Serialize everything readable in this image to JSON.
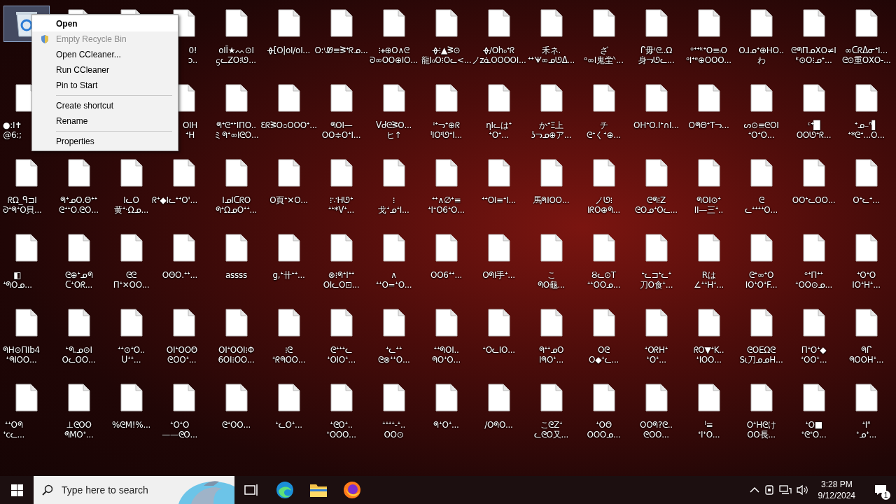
{
  "desktop": {
    "icons": [
      {
        "kind": "recycle-bin",
        "selected": true
      },
      {
        "kind": "file",
        "selected": false
      },
      {
        "kind": "file",
        "selected": false
      },
      {
        "kind": "file",
        "selected": false,
        "label": [
          "0!",
          "ɔ.."
        ]
      },
      {
        "kind": "file",
        "selected": false,
        "label": [
          "oΙΪ★ᨓ⊙Ι",
          "ᦓᓚΖΟ⁝ᘎ..."
        ]
      },
      {
        "kind": "file",
        "selected": false,
        "label": [
          "ᚖ[Ο|oΙ/oΙ..."
        ]
      },
      {
        "kind": "file",
        "selected": false,
        "label": [
          "Ο:ᶦᏪ≡ᕒᐩᖇᓄ..."
        ]
      },
      {
        "kind": "file",
        "selected": false,
        "label": [
          "⁝ᚐ⊕O∧ᘓ",
          "ᘐ∞ΟΟ⊕ΙΟ..."
        ]
      },
      {
        "kind": "file",
        "selected": false,
        "label": [
          "ᚖ⁝▲ᕒ⊙",
          "龍Ι₀Ο⁝Οᓚ<..."
        ]
      },
      {
        "kind": "file",
        "selected": false,
        "label": [
          "ᚖ∕Οh₀ᐩᖇ",
          "ノzᓈΟΟΟΟΙ..."
        ]
      },
      {
        "kind": "file",
        "selected": false,
        "label": [
          "禾ネ.",
          "ᐩᐩᗖ∞ᓄᘎᐃ..."
        ]
      },
      {
        "kind": "file",
        "selected": false,
        "label": [
          "ざ",
          "ᵒ∞Ι鬼坣ᐠ..."
        ]
      },
      {
        "kind": "file",
        "selected": false,
        "label": [
          "ᒋ毋ᶦᘓ..Ω",
          "身ᓓᘎᓚ..."
        ]
      },
      {
        "kind": "file",
        "selected": false,
        "label": [
          "ᵒᐩᐩᵏᐩΟ≡ᵢΟ",
          "ᵒΙᐩᵉ⊕ΟΟΟ..."
        ]
      },
      {
        "kind": "file",
        "selected": false,
        "label": [
          "Ο⅃ᓄᐩ⊕ΗΟ..",
          "わ"
        ]
      },
      {
        "kind": "file",
        "selected": false,
        "label": [
          "ᘓᖗΠᓄXΟ≠Ι",
          "ᵏ⊙Ο⁝ᓄᐩ..."
        ]
      },
      {
        "kind": "file",
        "selected": false,
        "label": [
          "∞ᑕᖇᐃᓂᐩΙ...",
          "ᘓ⊙重ΟXΟ-..."
        ]
      },
      {
        "kind": "file",
        "selected": false,
        "label": [
          "●:I✝",
          "@6:;"
        ]
      },
      {
        "kind": "hidden"
      },
      {
        "kind": "hidden"
      },
      {
        "kind": "file",
        "selected": false,
        "label": [
          "ΟΙH",
          "ᐩΗ"
        ]
      },
      {
        "kind": "file",
        "selected": false,
        "label": [
          "ᖗᐩᘓᐩᐩΙΠΟ..",
          "ミᖗᐩ∞ΙᘓΟ..."
        ]
      },
      {
        "kind": "file",
        "selected": false,
        "label": [
          "ƐᖇᕒΟ೦ΟΟΟᐩ..."
        ]
      },
      {
        "kind": "file",
        "selected": false,
        "label": [
          "ᖗΟΙ—",
          "ΟΟ≑ΟᐩΙ..."
        ]
      },
      {
        "kind": "file",
        "selected": false,
        "label": [
          "ᐯᑯᘓᕒΟ...",
          "ヒ↑"
        ]
      },
      {
        "kind": "file",
        "selected": false,
        "label": [
          "ᶦᐩᓓᐩ⊕ᖇ",
          "ᑊΙΟᶦᘎᐩΙ..."
        ]
      },
      {
        "kind": "file",
        "selected": false,
        "label": [
          "ηΙᓚはᐩ",
          "ᐩΟᐩ..."
        ]
      },
      {
        "kind": "file",
        "selected": false,
        "label": [
          "かᐩΞ上",
          "ʖᓓᓄ⊕ア..."
        ]
      },
      {
        "kind": "file",
        "selected": false,
        "label": [
          "チ",
          "ᘓᐩくᐩ⊕..."
        ]
      },
      {
        "kind": "file",
        "selected": false,
        "label": [
          "ΟΗᐩΟ.Ιᐩ∩Ι..."
        ]
      },
      {
        "kind": "file",
        "selected": false,
        "label": [
          "ΟᖗΘᐩΤᓓ..."
        ]
      },
      {
        "kind": "file",
        "selected": false,
        "label": [
          "ᔕ⊙≡ᘓΟΙ",
          "ᐩΟᐩΟ..."
        ]
      },
      {
        "kind": "file",
        "selected": false,
        "label": [
          "ᶜᐩ█",
          "ΟΟᘎᐩᖇ..."
        ]
      },
      {
        "kind": "file",
        "selected": false,
        "label": [
          "ᐩᓄ₋ᐢ▌",
          "ᐩ*ᘓᐩ...Ο..."
        ]
      },
      {
        "kind": "file",
        "selected": false,
        "label": [
          "ᖇΩ_ᑫ⊐Ι",
          "ᘐᐩᖗᐩΟ貝..."
        ]
      },
      {
        "kind": "file",
        "selected": false,
        "label": [
          "ᖗᐩᓄΟ.Θᐩᐩ",
          "ᘓᐩᐩΟ.ᘓΟ..."
        ]
      },
      {
        "kind": "file",
        "selected": false,
        "label": [
          "ΙᓚΟ",
          "黄ᐩ·Ωᓄ..."
        ]
      },
      {
        "kind": "file",
        "selected": false,
        "label": [
          "ᖇᐩ◆ΙᓚᐩᐩΟ'..."
        ]
      },
      {
        "kind": "file",
        "selected": false,
        "label": [
          "ΙᓄΙᑕᖇΟ",
          "ᖗᐩΩᓄΟᐩᐩ..."
        ]
      },
      {
        "kind": "file",
        "selected": false,
        "label": [
          "Ο頁ᐩ✕Ο..."
        ]
      },
      {
        "kind": "file",
        "selected": false,
        "label": [
          "⁝∵Ηᘎᐩ",
          "ᐩᐩ*ᐯᐩ..."
        ]
      },
      {
        "kind": "file",
        "selected": false,
        "label": [
          "⁝",
          "戈ᐩᓄᐩΙ..."
        ]
      },
      {
        "kind": "file",
        "selected": false,
        "label": [
          "ᐩᐩ∧∅ᐩ≡",
          "ᐩΙᐩΟ6ᐩΟ..."
        ]
      },
      {
        "kind": "file",
        "selected": false,
        "label": [
          "ᐩᐩΟΙ≡ᐩΙ..."
        ]
      },
      {
        "kind": "file",
        "selected": false,
        "label": [
          "馬ᖗΙΟΟ..."
        ]
      },
      {
        "kind": "file",
        "selected": false,
        "label": [
          "ノᘎ⁝",
          "ΙᖇΟ⊕ᖗ..."
        ]
      },
      {
        "kind": "file",
        "selected": false,
        "label": [
          "ᘓᖗ⁝Z",
          "ᘓΟᓄᐩΟᓚ..."
        ]
      },
      {
        "kind": "file",
        "selected": false,
        "label": [
          "ᖗΟΙ⊙ᐩ",
          "ΙΙ—三ᐩ.."
        ]
      },
      {
        "kind": "file",
        "selected": false,
        "label": [
          "ᘓ",
          "ᓚᐩᐩᐩᐩΟ..."
        ]
      },
      {
        "kind": "file",
        "selected": false,
        "label": [
          "ΟΟᐩᓚΟΟ..."
        ]
      },
      {
        "kind": "file",
        "selected": false,
        "label": [
          "Οᐩᓚᐩ..."
        ]
      },
      {
        "kind": "file",
        "selected": false,
        "label": [
          "◧",
          "ᐩᖗΟᓄ..."
        ]
      },
      {
        "kind": "file",
        "selected": false,
        "label": [
          "ᘓ⊕ᐩᓄᖗ",
          "ᑕᐩΟᖇ..."
        ]
      },
      {
        "kind": "file",
        "selected": false,
        "label": [
          "ᘓᘓ",
          "Πᐩ✕ΟΟ..."
        ]
      },
      {
        "kind": "file",
        "selected": false,
        "label": [
          "ΟΘΟ.ᐩᐩ..."
        ]
      },
      {
        "kind": "file",
        "selected": false,
        "label": [
          "assss"
        ]
      },
      {
        "kind": "file",
        "selected": false,
        "label": [
          "g,ᐩ卄ᐩᐩ..."
        ]
      },
      {
        "kind": "file",
        "selected": false,
        "label": [
          "⊗⁝ᖗᐩΙᐩᐩ",
          "ΟΙᓚΟ⊡..."
        ]
      },
      {
        "kind": "file",
        "selected": false,
        "label": [
          "∧",
          "ᐩᐩΟ=ᐩΟ..."
        ]
      },
      {
        "kind": "file",
        "selected": false,
        "label": [
          "ΟΟ6ᐩᐩ..."
        ]
      },
      {
        "kind": "file",
        "selected": false,
        "label": [
          "ΟᖗΙ手ᐩ..."
        ]
      },
      {
        "kind": "file",
        "selected": false,
        "label": [
          "こ",
          "ᖗΟ龜..."
        ]
      },
      {
        "kind": "file",
        "selected": false,
        "label": [
          "Ȣᓚ⊙Τ",
          "ᐩᐩΟΟᓄ..."
        ]
      },
      {
        "kind": "file",
        "selected": false,
        "label": [
          "ᐩᓚ⊐ᐩᓚᐩ",
          "刀Ο食ᐩ..."
        ]
      },
      {
        "kind": "file",
        "selected": false,
        "label": [
          "Rは",
          "∠ᐩᐩΗᐩ..."
        ]
      },
      {
        "kind": "file",
        "selected": false,
        "label": [
          "ᘓᐩ∞ᐩΟ",
          "ΙΟᐩΟᐩF..."
        ]
      },
      {
        "kind": "file",
        "selected": false,
        "label": [
          "ᵒᐩΠᐩᐩ",
          "ᐩΟΟ⊙ᓄ..."
        ]
      },
      {
        "kind": "file",
        "selected": false,
        "label": [
          "ᐩΟᐩΟ",
          "ΙΟᐩΗᐩ..."
        ]
      },
      {
        "kind": "file",
        "selected": false,
        "label": [
          "ᖗΗ⊙ΠΙb4",
          "ᐩᖗΙΟΟ..."
        ]
      },
      {
        "kind": "file",
        "selected": false,
        "label": [
          "ᐩᖗ.ᓄ⊙Ι",
          "ΟᓚΟΟ..."
        ]
      },
      {
        "kind": "file",
        "selected": false,
        "label": [
          "ᐩᐩ⊙ᐩΟ..",
          "ᑌᐩᐩ..."
        ]
      },
      {
        "kind": "file",
        "selected": false,
        "label": [
          "ΟΙᐩΟΟΘ",
          "ᘓΟΟᐩ..."
        ]
      },
      {
        "kind": "file",
        "selected": false,
        "label": [
          "ΟΙᐩΟΟΙ⁝Φ",
          "6ΟΙ⁝ΟΟ..."
        ]
      },
      {
        "kind": "file",
        "selected": false,
        "label": [
          "⁝ᘓ",
          "ᐩᖇᖗΟΟ..."
        ]
      },
      {
        "kind": "file",
        "selected": false,
        "label": [
          "ᘓᐩᐩᐩᓚ",
          "ᐩΟΙΟᐩ..."
        ]
      },
      {
        "kind": "file",
        "selected": false,
        "label": [
          "ᐩᓚᐩᐩ",
          "ᘓ⊗ᐩᐩΟ..."
        ]
      },
      {
        "kind": "file",
        "selected": false,
        "label": [
          "ᐩᐩᖗΟΙ..",
          "ᖗΟᐩΟ..."
        ]
      },
      {
        "kind": "file",
        "selected": false,
        "label": [
          "ᐩΟᓚΙΟ..."
        ]
      },
      {
        "kind": "file",
        "selected": false,
        "label": [
          "ᖗᐩᐩᓄΟ",
          "ΙᖗΟᐩ..."
        ]
      },
      {
        "kind": "file",
        "selected": false,
        "label": [
          "Οᘓ",
          "Ο◆ᐩᓚ..."
        ]
      },
      {
        "kind": "file",
        "selected": false,
        "label": [
          "ᐩΟᖇΗᐩ",
          "ᐩΟᐩ..."
        ]
      },
      {
        "kind": "file",
        "selected": false,
        "label": [
          "ᖇΟ▼ᐩΚ..",
          "ᐩΙΟΟ..."
        ]
      },
      {
        "kind": "file",
        "selected": false,
        "label": [
          "ᘓΟΕΩᘓ",
          "Sι刀ᓄᓄΗ..."
        ]
      },
      {
        "kind": "file",
        "selected": false,
        "label": [
          "ΠᐩΟᐩ◆",
          "ᐩΟΟᐩ..."
        ]
      },
      {
        "kind": "file",
        "selected": false,
        "label": [
          "ᖗᒋ",
          "ᖗΟΟΗᐩ..."
        ]
      },
      {
        "kind": "file",
        "selected": false,
        "label": [
          "ᐩᐩΟᖗ",
          "ᐩcᓚ..."
        ]
      },
      {
        "kind": "file",
        "selected": false,
        "label": [
          "⊥ᘓΟΟ",
          "ᖗΜΟᐩ..."
        ]
      },
      {
        "kind": "file",
        "selected": false,
        "label": [
          "%ᘓΜ!%..."
        ]
      },
      {
        "kind": "file",
        "selected": false,
        "label": [
          "ᐩΟᐩΟ",
          "——ᘓΟ..."
        ]
      },
      {
        "kind": "file",
        "selected": false,
        "label": [
          "ᘓᐩΟΟ..."
        ]
      },
      {
        "kind": "file",
        "selected": false,
        "label": [
          "ᐩᓚΟᐩ..."
        ]
      },
      {
        "kind": "file",
        "selected": false,
        "label": [
          "ᐩᘓΟᐩ..",
          "ᐩΟΟΟ..."
        ]
      },
      {
        "kind": "file",
        "selected": false,
        "label": [
          "ᐩᐩᐩᐩ-ᐩ..",
          "ΟΟ⊙"
        ]
      },
      {
        "kind": "file",
        "selected": false,
        "label": [
          "ᖗᐩΟᐩ..."
        ]
      },
      {
        "kind": "file",
        "selected": false,
        "label": [
          "/ΟᖗΟ..."
        ]
      },
      {
        "kind": "file",
        "selected": false,
        "label": [
          "こᘓΖᐩ",
          "ᓚᘓΟ又..."
        ]
      },
      {
        "kind": "file",
        "selected": false,
        "label": [
          "ᐩΟΘ",
          "ΟΟΟᓄ..."
        ]
      },
      {
        "kind": "file",
        "selected": false,
        "label": [
          "ΟΟᖗ?ᘓ..",
          "ᘓΟΟ..."
        ]
      },
      {
        "kind": "file",
        "selected": false,
        "label": [
          "ᑊ≡",
          "ᐩΙᐩΟ..."
        ]
      },
      {
        "kind": "file",
        "selected": false,
        "label": [
          "ΟᐩΗᘓけ",
          "ΟΟ長..."
        ]
      },
      {
        "kind": "file",
        "selected": false,
        "label": [
          "ᐩΟ■",
          "ᐩᘓᐩΟ..."
        ]
      },
      {
        "kind": "file",
        "selected": false,
        "label": [
          "ᐩΙᐢ",
          "ᐩᓄᐩ..."
        ]
      }
    ]
  },
  "context_menu": {
    "items": [
      {
        "kind": "item",
        "label": "Open",
        "default": true,
        "disabled": false
      },
      {
        "kind": "item",
        "label": "Empty Recycle Bin",
        "default": false,
        "disabled": true,
        "shield": true
      },
      {
        "kind": "item",
        "label": "Open CCleaner...",
        "default": false,
        "disabled": false
      },
      {
        "kind": "item",
        "label": "Run CCleaner",
        "default": false,
        "disabled": false
      },
      {
        "kind": "item",
        "label": "Pin to Start",
        "default": false,
        "disabled": false
      },
      {
        "kind": "separator"
      },
      {
        "kind": "item",
        "label": "Create shortcut",
        "default": false,
        "disabled": false
      },
      {
        "kind": "item",
        "label": "Rename",
        "default": false,
        "disabled": false
      },
      {
        "kind": "separator"
      },
      {
        "kind": "item",
        "label": "Properties",
        "default": false,
        "disabled": false
      }
    ]
  },
  "taskbar": {
    "search": {
      "placeholder": "Type here to search"
    },
    "apps": [
      {
        "kind": "task-view"
      },
      {
        "kind": "edge"
      },
      {
        "kind": "explorer"
      },
      {
        "kind": "firefox"
      }
    ],
    "clock": {
      "time": "3:28 PM",
      "date": "9/12/2024"
    },
    "notifications": {
      "count": "1"
    }
  }
}
